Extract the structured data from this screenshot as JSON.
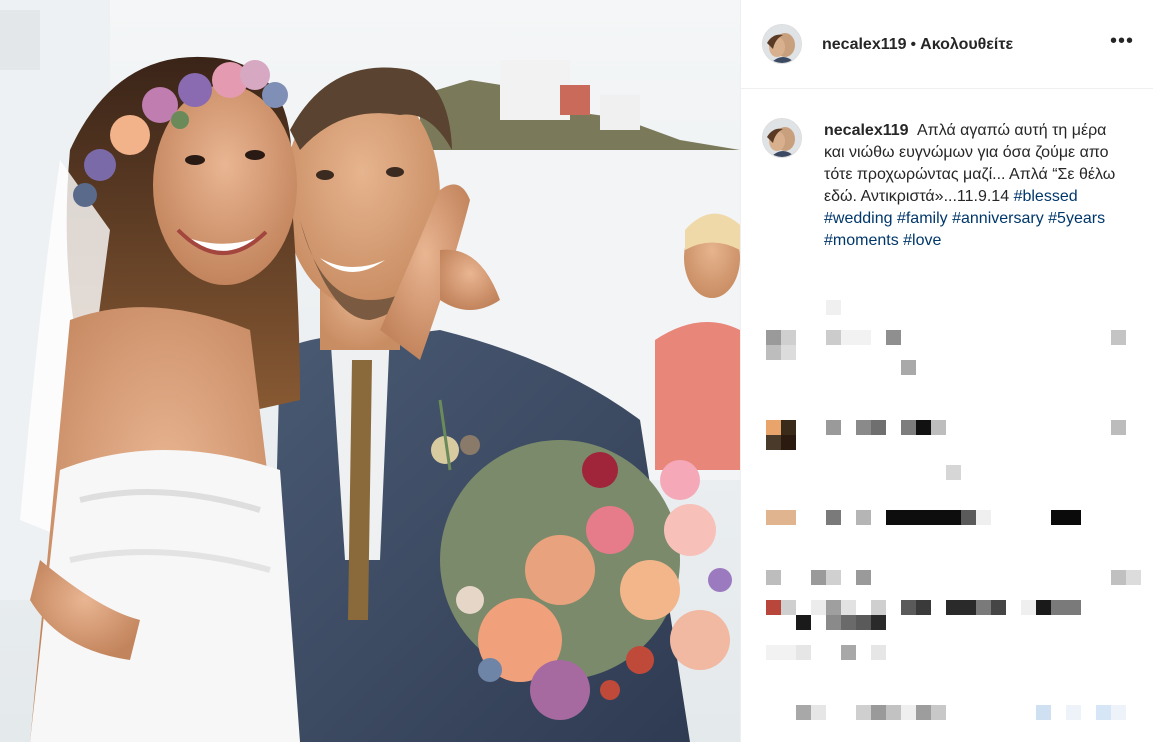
{
  "post": {
    "username": "necalex119",
    "dot": "•",
    "follow_label": "Ακολουθείτε",
    "more_label": "•••",
    "caption": {
      "username": "necalex119",
      "text": "Απλά αγαπώ αυτή τη μέρα και νιώθω ευγνώμων για όσα ζούμε απο τότε προχωρώντας μαζί... Απλά “Σε θέλω εδώ. Αντικριστά»...11.9.14",
      "hashtags": [
        "#blessed",
        "#wedding",
        "#family",
        "#anniversary",
        "#5years",
        "#moments",
        "#love"
      ]
    }
  },
  "colors": {
    "text": "#262626",
    "hashtag": "#00376b",
    "border": "#efefef"
  },
  "icons": {
    "more": "more-options-icon",
    "avatar": "profile-avatar"
  }
}
